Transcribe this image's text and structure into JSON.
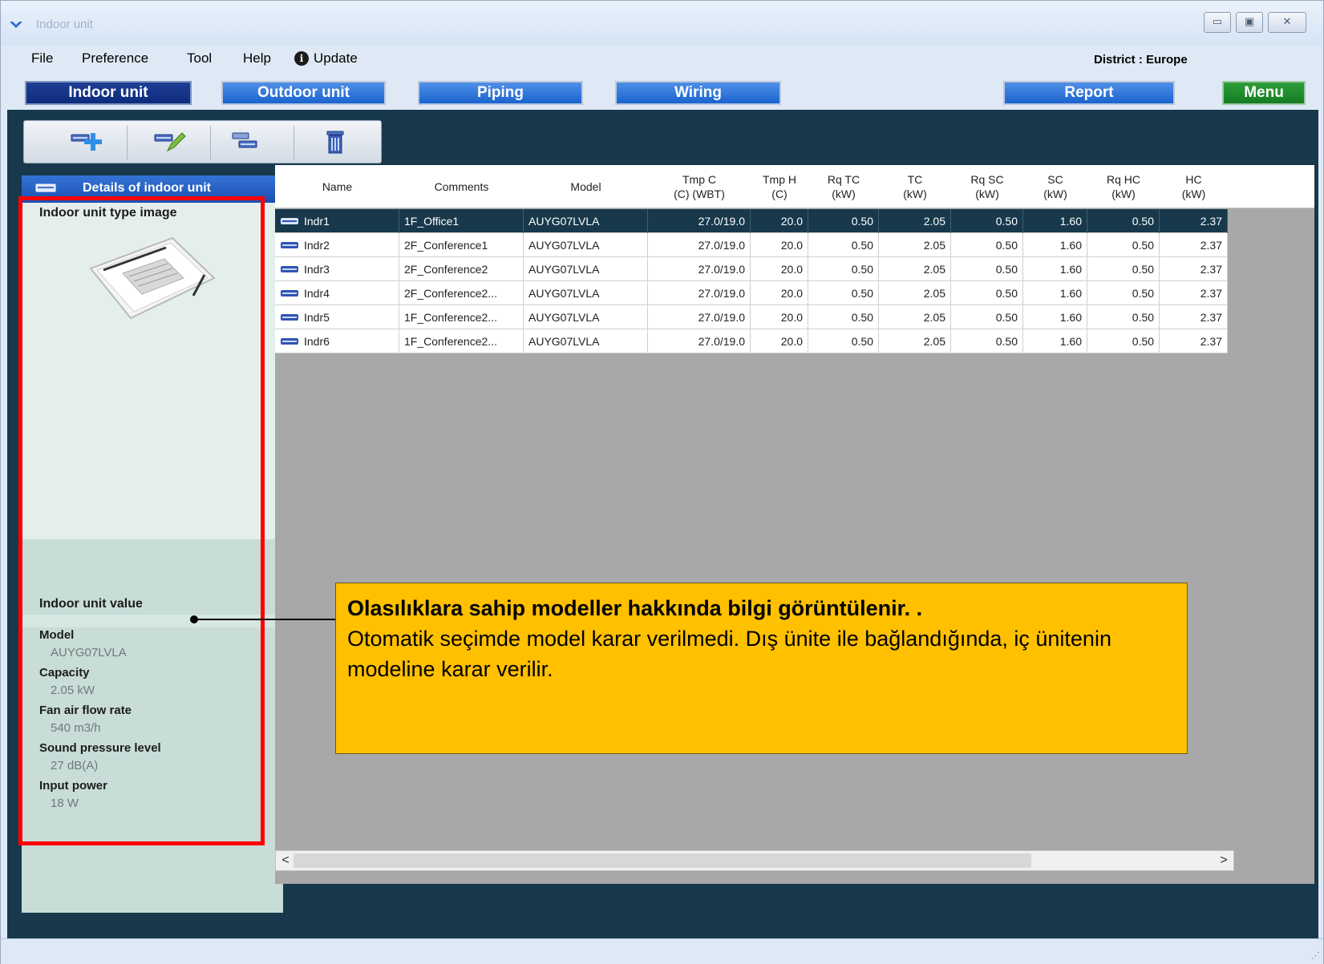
{
  "window": {
    "title": "Indoor unit",
    "controls": {
      "minimize": "▭",
      "maximize": "▣",
      "close": "✕"
    }
  },
  "menubar": {
    "items": [
      "File",
      "Preference",
      "Tool",
      "Help"
    ],
    "update": "Update",
    "district": "District : Europe"
  },
  "tabs": {
    "indoor": "Indoor unit",
    "outdoor": "Outdoor unit",
    "piping": "Piping",
    "wiring": "Wiring",
    "report": "Report",
    "menu": "Menu"
  },
  "toolbar": {
    "buttons": [
      "add-unit-icon",
      "edit-unit-icon",
      "copy-unit-icon",
      "delete-icon"
    ]
  },
  "left_panel": {
    "header": "Details of indoor unit",
    "type_image_label": "Indoor unit type image",
    "value_label": "Indoor unit value",
    "model_key": "Model",
    "model_value": "AUYG07LVLA",
    "capacity_key": "Capacity",
    "capacity_value": "2.05 kW",
    "fan_key": "Fan air flow rate",
    "fan_value": "540 m3/h",
    "sound_key": "Sound pressure level",
    "sound_value": "27 dB(A)",
    "power_key": "Input power",
    "power_value": "18 W"
  },
  "grid": {
    "headers": [
      [
        "Name",
        ""
      ],
      [
        "Comments",
        ""
      ],
      [
        "Model",
        ""
      ],
      [
        "Tmp C",
        "(C) (WBT)"
      ],
      [
        "Tmp H",
        "(C)"
      ],
      [
        "Rq TC",
        "(kW)"
      ],
      [
        "TC",
        "(kW)"
      ],
      [
        "Rq SC",
        "(kW)"
      ],
      [
        "SC",
        "(kW)"
      ],
      [
        "Rq HC",
        "(kW)"
      ],
      [
        "HC",
        "(kW)"
      ]
    ],
    "rows": [
      [
        "Indr1",
        "1F_Office1",
        "AUYG07LVLA",
        "27.0/19.0",
        "20.0",
        "0.50",
        "2.05",
        "0.50",
        "1.60",
        "0.50",
        "2.37"
      ],
      [
        "Indr2",
        "2F_Conference1",
        "AUYG07LVLA",
        "27.0/19.0",
        "20.0",
        "0.50",
        "2.05",
        "0.50",
        "1.60",
        "0.50",
        "2.37"
      ],
      [
        "Indr3",
        "2F_Conference2",
        "AUYG07LVLA",
        "27.0/19.0",
        "20.0",
        "0.50",
        "2.05",
        "0.50",
        "1.60",
        "0.50",
        "2.37"
      ],
      [
        "Indr4",
        "2F_Conference2...",
        "AUYG07LVLA",
        "27.0/19.0",
        "20.0",
        "0.50",
        "2.05",
        "0.50",
        "1.60",
        "0.50",
        "2.37"
      ],
      [
        "Indr5",
        "1F_Conference2...",
        "AUYG07LVLA",
        "27.0/19.0",
        "20.0",
        "0.50",
        "2.05",
        "0.50",
        "1.60",
        "0.50",
        "2.37"
      ],
      [
        "Indr6",
        "1F_Conference2...",
        "AUYG07LVLA",
        "27.0/19.0",
        "20.0",
        "0.50",
        "2.05",
        "0.50",
        "1.60",
        "0.50",
        "2.37"
      ]
    ],
    "selected_row": 0,
    "scroll_left": "<",
    "scroll_right": ">"
  },
  "callout": {
    "title": "Olasılıklara sahip modeller hakkında bilgi görüntülenir. .",
    "body": "Otomatik seçimde model karar verilmedi. Dış ünite ile bağlandığında, iç ünitenin modeline karar verilir."
  },
  "colors": {
    "accent_blue": "#1a63cf",
    "active_tab": "#0d2b7c",
    "menu_green": "#137d22",
    "selection": "#17394b",
    "highlight_box": "#ff0000",
    "callout_bg": "#ffc000"
  }
}
